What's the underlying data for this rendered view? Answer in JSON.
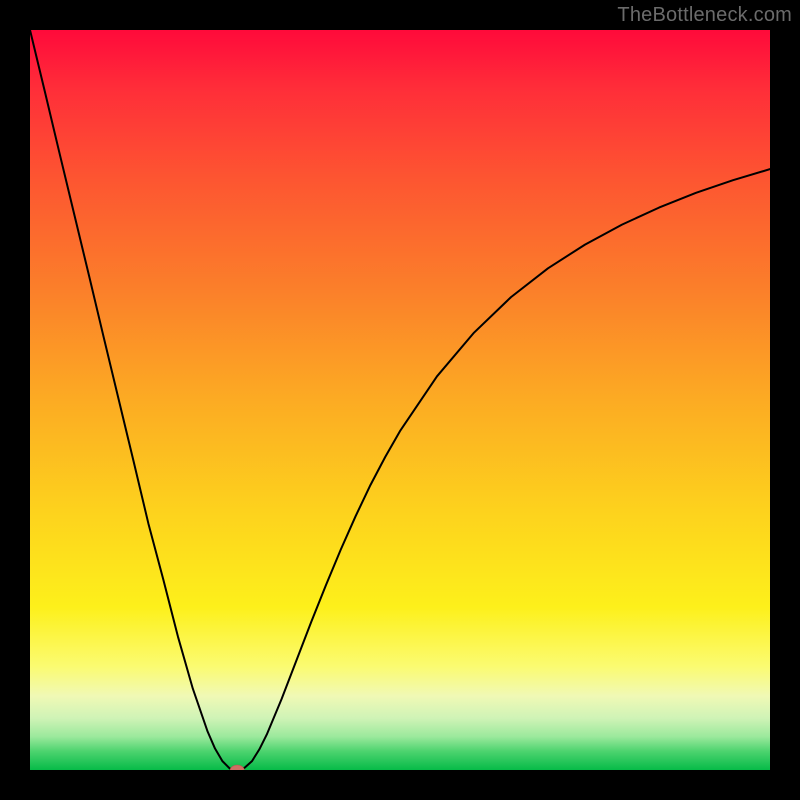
{
  "watermark": "TheBottleneck.com",
  "chart_data": {
    "type": "line",
    "title": "",
    "xlabel": "",
    "ylabel": "",
    "xlim": [
      0,
      100
    ],
    "ylim": [
      0,
      100
    ],
    "grid": false,
    "x": [
      0,
      2,
      4,
      6,
      8,
      10,
      12,
      14,
      16,
      18,
      20,
      22,
      24,
      25,
      26,
      27,
      28,
      29,
      30,
      31,
      32,
      34,
      36,
      38,
      40,
      42,
      44,
      46,
      48,
      50,
      55,
      60,
      65,
      70,
      75,
      80,
      85,
      90,
      95,
      100
    ],
    "values": [
      100,
      91.7,
      83.3,
      75,
      66.7,
      58.3,
      50,
      41.7,
      33.3,
      25.8,
      18,
      11,
      5.2,
      2.9,
      1.2,
      0.2,
      0,
      0.3,
      1.2,
      2.8,
      4.8,
      9.6,
      14.8,
      20,
      25,
      29.8,
      34.3,
      38.5,
      42.3,
      45.8,
      53.2,
      59.1,
      63.9,
      67.8,
      71,
      73.7,
      76,
      78.0,
      79.7,
      81.2
    ],
    "marker": {
      "x": 28,
      "y": 0,
      "color": "#cf7064"
    },
    "curve_color": "#000000",
    "background_gradient_stops": [
      {
        "pos": 0,
        "color": "#ff0a3a"
      },
      {
        "pos": 20,
        "color": "#fd5531"
      },
      {
        "pos": 50,
        "color": "#fcab23"
      },
      {
        "pos": 78,
        "color": "#fdf01b"
      },
      {
        "pos": 90,
        "color": "#f0f9b5"
      },
      {
        "pos": 95.5,
        "color": "#9be99c"
      },
      {
        "pos": 100,
        "color": "#06bb48"
      }
    ]
  }
}
